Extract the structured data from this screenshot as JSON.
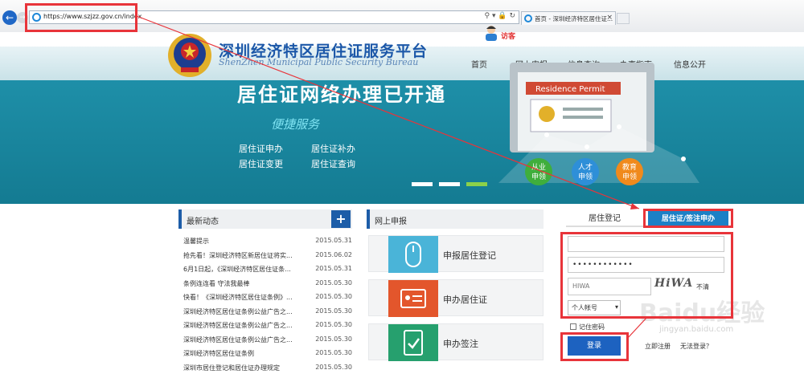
{
  "browser": {
    "url": "https://www.szjzz.gov.cn/index",
    "tab_title": "首页 - 深圳经济特区居住证...",
    "visitor_label": "访客"
  },
  "site": {
    "title": "深圳经济特区居住证服务平台",
    "subtitle": "ShenZhen Municipal Public Security Bureau",
    "nav": [
      "首页",
      "网上申报",
      "信息查询",
      "办事指南",
      "信息公开"
    ]
  },
  "banner": {
    "headline": "居住证网络办理已开通",
    "tagline": "便捷服务",
    "links": [
      "居住证申办",
      "居住证补办",
      "居住证变更",
      "居住证查询"
    ],
    "card_title": "Residence Permit",
    "bubbles": [
      "从业\n申领",
      "人才\n申领",
      "教育\n申领"
    ],
    "colors": {
      "bubble1": "#3fae3c",
      "bubble2": "#2e8fd8",
      "bubble3": "#f08a1c"
    }
  },
  "news": {
    "title": "最新动态",
    "items": [
      {
        "title": "温馨提示",
        "date": "2015.05.31"
      },
      {
        "title": "抢先看！深圳经济特区新居住证将实...",
        "date": "2015.06.02"
      },
      {
        "title": "6月1日起，《深圳经济特区居住证条...",
        "date": "2015.05.31"
      },
      {
        "title": "条例连连看 守法我最棒",
        "date": "2015.05.30"
      },
      {
        "title": "快看！《深圳经济特区居住证条例》...",
        "date": "2015.05.30"
      },
      {
        "title": "深圳经济特区居住证条例公益广告之...",
        "date": "2015.05.30"
      },
      {
        "title": "深圳经济特区居住证条例公益广告之...",
        "date": "2015.05.30"
      },
      {
        "title": "深圳经济特区居住证条例公益广告之...",
        "date": "2015.05.30"
      },
      {
        "title": "深圳经济特区居住证条例",
        "date": "2015.05.30"
      },
      {
        "title": "深圳市居住登记和居住证办理规定",
        "date": "2015.05.30"
      }
    ]
  },
  "apply": {
    "title": "网上申报",
    "services": [
      {
        "label": "申报居住登记",
        "icon": "mouse-icon",
        "color": "#4ab4d8"
      },
      {
        "label": "申办居住证",
        "icon": "id-card-icon",
        "color": "#e3562c"
      },
      {
        "label": "申办签注",
        "icon": "clipboard-check-icon",
        "color": "#26a06e"
      }
    ]
  },
  "login": {
    "tab_register": "居住登记",
    "tab_visa": "居住证/签注申办",
    "username_value": "",
    "password_value": "••••••••••••",
    "captcha_value": "HIWA",
    "captcha_image_text": "HiWA",
    "captcha_refresh": "不清",
    "account_type": "个人帐号",
    "remember_label": "记住密码",
    "login_button": "登录",
    "register_link": "立即注册",
    "forgot_link": "无法登录？"
  },
  "watermark": {
    "brand": "Baidu经验",
    "domain": "jingyan.baidu.com"
  }
}
